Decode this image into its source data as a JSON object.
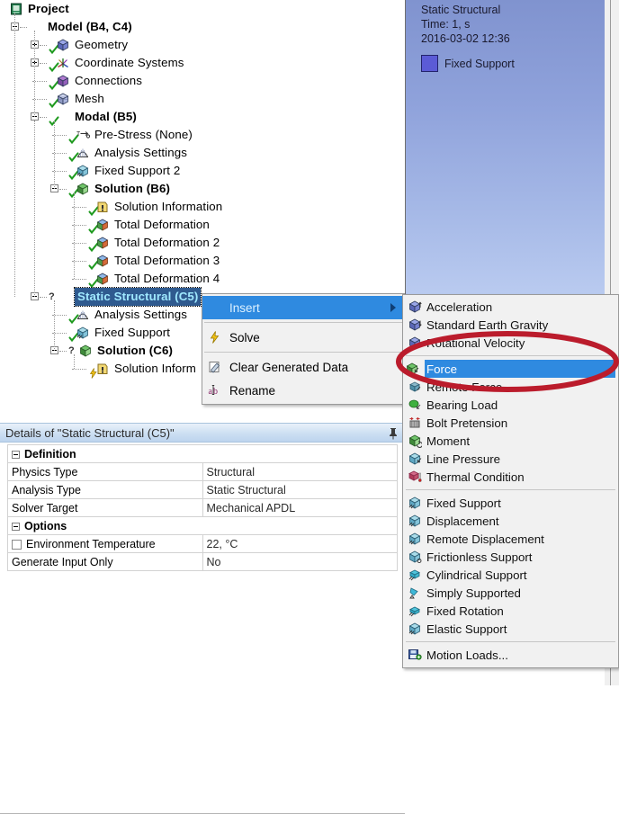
{
  "tree": {
    "items": [
      {
        "label": "Project",
        "depth": 0,
        "bold": true,
        "icon": "project-icon",
        "expander": "none",
        "status": "none"
      },
      {
        "label": "Model (B4, C4)",
        "depth": 1,
        "bold": true,
        "icon": "model-icon",
        "expander": "minus",
        "status": "none"
      },
      {
        "label": "Geometry",
        "depth": 2,
        "bold": false,
        "icon": "geometry-icon",
        "expander": "plus",
        "status": "check"
      },
      {
        "label": "Coordinate Systems",
        "depth": 2,
        "bold": false,
        "icon": "coordinate-systems-icon",
        "expander": "plus",
        "status": "check"
      },
      {
        "label": "Connections",
        "depth": 2,
        "bold": false,
        "icon": "connections-icon",
        "expander": "none",
        "status": "check"
      },
      {
        "label": "Mesh",
        "depth": 2,
        "bold": false,
        "icon": "mesh-icon",
        "expander": "none",
        "status": "check"
      },
      {
        "label": "Modal (B5)",
        "depth": 2,
        "bold": true,
        "icon": "modal-branch-icon",
        "expander": "minus",
        "status": "check"
      },
      {
        "label": "Pre-Stress (None)",
        "depth": 3,
        "bold": false,
        "icon": "pre-stress-icon",
        "expander": "none",
        "status": "check"
      },
      {
        "label": "Analysis Settings",
        "depth": 3,
        "bold": false,
        "icon": "analysis-settings-icon",
        "expander": "none",
        "status": "check"
      },
      {
        "label": "Fixed Support 2",
        "depth": 3,
        "bold": false,
        "icon": "fixed-support-icon",
        "expander": "none",
        "status": "check"
      },
      {
        "label": "Solution (B6)",
        "depth": 3,
        "bold": true,
        "icon": "solution-icon",
        "expander": "minus",
        "status": "check"
      },
      {
        "label": "Solution Information",
        "depth": 4,
        "bold": false,
        "icon": "solution-information-icon",
        "expander": "none",
        "status": "check"
      },
      {
        "label": "Total Deformation",
        "depth": 4,
        "bold": false,
        "icon": "total-deformation-icon",
        "expander": "none",
        "status": "check"
      },
      {
        "label": "Total Deformation 2",
        "depth": 4,
        "bold": false,
        "icon": "total-deformation-icon",
        "expander": "none",
        "status": "check"
      },
      {
        "label": "Total Deformation 3",
        "depth": 4,
        "bold": false,
        "icon": "total-deformation-icon",
        "expander": "none",
        "status": "check"
      },
      {
        "label": "Total Deformation 4",
        "depth": 4,
        "bold": false,
        "icon": "total-deformation-icon",
        "expander": "none",
        "status": "check"
      },
      {
        "label": "Static Structural (C5)",
        "depth": 2,
        "bold": true,
        "icon": "static-structural-icon",
        "expander": "minus",
        "status": "question",
        "selected": true
      },
      {
        "label": "Analysis Settings",
        "depth": 3,
        "bold": false,
        "icon": "analysis-settings-icon",
        "expander": "none",
        "status": "check"
      },
      {
        "label": "Fixed Support",
        "depth": 3,
        "bold": false,
        "icon": "fixed-support-icon",
        "expander": "none",
        "status": "check"
      },
      {
        "label": "Solution (C6)",
        "depth": 3,
        "bold": true,
        "icon": "solution-icon",
        "expander": "minus",
        "status": "question"
      },
      {
        "label": "Solution Inform",
        "depth": 4,
        "bold": false,
        "icon": "solution-information-icon",
        "expander": "none",
        "status": "bolt"
      }
    ]
  },
  "viewport": {
    "title": "Static Structural",
    "time": "Time: 1, s",
    "timestamp": "2016-03-02 12:36",
    "legend_label": "Fixed Support",
    "legend_color": "#5b5bd6"
  },
  "details": {
    "title": "Details of \"Static Structural (C5)\"",
    "groups": [
      {
        "name": "Definition",
        "rows": [
          {
            "key": "Physics Type",
            "value": "Structural",
            "checkbox": false
          },
          {
            "key": "Analysis Type",
            "value": "Static Structural",
            "checkbox": false
          },
          {
            "key": "Solver Target",
            "value": "Mechanical APDL",
            "checkbox": false
          }
        ]
      },
      {
        "name": "Options",
        "rows": [
          {
            "key": "Environment Temperature",
            "value": "22, °C",
            "checkbox": true
          },
          {
            "key": "Generate Input Only",
            "value": "No",
            "checkbox": false
          }
        ]
      }
    ]
  },
  "context_menu": {
    "items": [
      {
        "label": "Insert",
        "icon": "none",
        "highlighted": true,
        "submenu": true
      },
      {
        "type": "separator"
      },
      {
        "label": "Solve",
        "icon": "solve-lightning-icon",
        "highlighted": false,
        "submenu": false
      },
      {
        "type": "separator"
      },
      {
        "label": "Clear Generated Data",
        "icon": "clear-generated-data-icon",
        "highlighted": false,
        "submenu": false
      },
      {
        "label": "Rename",
        "icon": "rename-icon",
        "highlighted": false,
        "submenu": false
      }
    ]
  },
  "submenu": {
    "items": [
      {
        "label": "Acceleration",
        "icon": "acceleration-icon",
        "highlighted": false
      },
      {
        "label": "Standard Earth Gravity",
        "icon": "standard-earth-gravity-icon",
        "highlighted": false
      },
      {
        "label": "Rotational Velocity",
        "icon": "rotational-velocity-icon",
        "highlighted": false
      },
      {
        "type": "separator"
      },
      {
        "label": "Force",
        "icon": "force-icon",
        "highlighted": true
      },
      {
        "label": "Remote Force",
        "icon": "remote-force-icon",
        "highlighted": false
      },
      {
        "label": "Bearing Load",
        "icon": "bearing-load-icon",
        "highlighted": false
      },
      {
        "label": "Bolt Pretension",
        "icon": "bolt-pretension-icon",
        "highlighted": false
      },
      {
        "label": "Moment",
        "icon": "moment-icon",
        "highlighted": false
      },
      {
        "label": "Line Pressure",
        "icon": "line-pressure-icon",
        "highlighted": false
      },
      {
        "label": "Thermal Condition",
        "icon": "thermal-condition-icon",
        "highlighted": false
      },
      {
        "type": "separator"
      },
      {
        "label": "Fixed Support",
        "icon": "fixed-support-icon",
        "highlighted": false
      },
      {
        "label": "Displacement",
        "icon": "displacement-icon",
        "highlighted": false
      },
      {
        "label": "Remote Displacement",
        "icon": "remote-displacement-icon",
        "highlighted": false
      },
      {
        "label": "Frictionless Support",
        "icon": "frictionless-support-icon",
        "highlighted": false
      },
      {
        "label": "Cylindrical Support",
        "icon": "cylindrical-support-icon",
        "highlighted": false
      },
      {
        "label": "Simply Supported",
        "icon": "simply-supported-icon",
        "highlighted": false
      },
      {
        "label": "Fixed Rotation",
        "icon": "fixed-rotation-icon",
        "highlighted": false
      },
      {
        "label": "Elastic Support",
        "icon": "elastic-support-icon",
        "highlighted": false
      },
      {
        "type": "separator"
      },
      {
        "label": "Motion Loads...",
        "icon": "motion-loads-icon",
        "highlighted": false
      }
    ]
  },
  "annotation": {
    "shape": "ellipse",
    "color": "#bb1c2c",
    "target": "Force"
  }
}
